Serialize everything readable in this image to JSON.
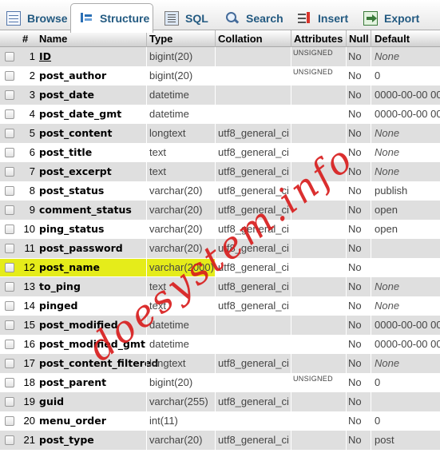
{
  "tabs": [
    {
      "label": "Browse",
      "icon": "browse-icon"
    },
    {
      "label": "Structure",
      "icon": "structure-icon",
      "active": true
    },
    {
      "label": "SQL",
      "icon": "sql-icon"
    },
    {
      "label": "Search",
      "icon": "search-icon"
    },
    {
      "label": "Insert",
      "icon": "insert-icon"
    },
    {
      "label": "Export",
      "icon": "export-icon"
    }
  ],
  "columns": {
    "num": "#",
    "name": "Name",
    "type": "Type",
    "collation": "Collation",
    "attributes": "Attributes",
    "null": "Null",
    "default": "Default"
  },
  "rows": [
    {
      "num": "1",
      "name": "ID",
      "type": "bigint(20)",
      "collation": "",
      "attributes": "UNSIGNED",
      "null": "No",
      "default": "None"
    },
    {
      "num": "2",
      "name": "post_author",
      "type": "bigint(20)",
      "collation": "",
      "attributes": "UNSIGNED",
      "null": "No",
      "default": "0"
    },
    {
      "num": "3",
      "name": "post_date",
      "type": "datetime",
      "collation": "",
      "attributes": "",
      "null": "No",
      "default": "0000-00-00 00"
    },
    {
      "num": "4",
      "name": "post_date_gmt",
      "type": "datetime",
      "collation": "",
      "attributes": "",
      "null": "No",
      "default": "0000-00-00 00"
    },
    {
      "num": "5",
      "name": "post_content",
      "type": "longtext",
      "collation": "utf8_general_ci",
      "attributes": "",
      "null": "No",
      "default": "None"
    },
    {
      "num": "6",
      "name": "post_title",
      "type": "text",
      "collation": "utf8_general_ci",
      "attributes": "",
      "null": "No",
      "default": "None"
    },
    {
      "num": "7",
      "name": "post_excerpt",
      "type": "text",
      "collation": "utf8_general_ci",
      "attributes": "",
      "null": "No",
      "default": "None"
    },
    {
      "num": "8",
      "name": "post_status",
      "type": "varchar(20)",
      "collation": "utf8_general_ci",
      "attributes": "",
      "null": "No",
      "default": "publish"
    },
    {
      "num": "9",
      "name": "comment_status",
      "type": "varchar(20)",
      "collation": "utf8_general_ci",
      "attributes": "",
      "null": "No",
      "default": "open"
    },
    {
      "num": "10",
      "name": "ping_status",
      "type": "varchar(20)",
      "collation": "utf8_general_ci",
      "attributes": "",
      "null": "No",
      "default": "open"
    },
    {
      "num": "11",
      "name": "post_password",
      "type": "varchar(20)",
      "collation": "utf8_general_ci",
      "attributes": "",
      "null": "No",
      "default": ""
    },
    {
      "num": "12",
      "name": "post_name",
      "type": "varchar(2000)",
      "collation": "utf8_general_ci",
      "attributes": "",
      "null": "No",
      "default": "",
      "highlighted": true
    },
    {
      "num": "13",
      "name": "to_ping",
      "type": "text",
      "collation": "utf8_general_ci",
      "attributes": "",
      "null": "No",
      "default": "None"
    },
    {
      "num": "14",
      "name": "pinged",
      "type": "text",
      "collation": "utf8_general_ci",
      "attributes": "",
      "null": "No",
      "default": "None"
    },
    {
      "num": "15",
      "name": "post_modified",
      "type": "datetime",
      "collation": "",
      "attributes": "",
      "null": "No",
      "default": "0000-00-00 00"
    },
    {
      "num": "16",
      "name": "post_modified_gmt",
      "type": "datetime",
      "collation": "",
      "attributes": "",
      "null": "No",
      "default": "0000-00-00 00"
    },
    {
      "num": "17",
      "name": "post_content_filtered",
      "type": "longtext",
      "collation": "utf8_general_ci",
      "attributes": "",
      "null": "No",
      "default": "None"
    },
    {
      "num": "18",
      "name": "post_parent",
      "type": "bigint(20)",
      "collation": "",
      "attributes": "UNSIGNED",
      "null": "No",
      "default": "0"
    },
    {
      "num": "19",
      "name": "guid",
      "type": "varchar(255)",
      "collation": "utf8_general_ci",
      "attributes": "",
      "null": "No",
      "default": ""
    },
    {
      "num": "20",
      "name": "menu_order",
      "type": "int(11)",
      "collation": "",
      "attributes": "",
      "null": "No",
      "default": "0"
    },
    {
      "num": "21",
      "name": "post_type",
      "type": "varchar(20)",
      "collation": "utf8_general_ci",
      "attributes": "",
      "null": "No",
      "default": "post"
    }
  ],
  "watermark": "doesystem.info",
  "colors": {
    "link": "#235a81",
    "highlight": "#e5ec1a",
    "watermark": "#d81e1e",
    "row_alt": "#dfdfdf"
  }
}
